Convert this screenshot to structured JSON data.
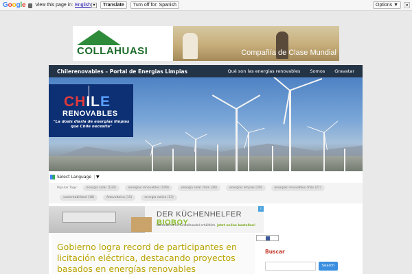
{
  "translate_bar": {
    "logo": "Google",
    "view_text": "View this page in:",
    "language": "English",
    "translate_label": "Translate",
    "turn_off_label": "Turn off for: Spanish",
    "options_label": "Options ▼",
    "close_label": "✕"
  },
  "top_ad": {
    "brand": "COLLAHUASI",
    "slogan": "Compañía de Clase Mundial"
  },
  "nav": {
    "site_title": "Chilerenovables – Portal de Energias Limpias",
    "links": [
      "Qué son las energías renovables",
      "Somos",
      "Gravatar"
    ]
  },
  "header_logo": {
    "chile_1": "CH",
    "chile_2": "IL",
    "chile_3": "E",
    "renovables": "RENOVABLES",
    "tagline": "\"La dosis diaria de energías limpias que Chile necesita\""
  },
  "language_selector": {
    "label": "Select Language",
    "arrow": "▼"
  },
  "tags": {
    "label": "Popular Tags:",
    "row1": [
      "energia solar (133)",
      "energias renovables (109)",
      "energia solar chile (36)",
      "energías limpias (30)",
      "energias renovables chile (21)"
    ],
    "row2": [
      "sustentabilidad (18)",
      "fotovoltaica (15)",
      "energia eolica (13)"
    ]
  },
  "ad_kuechen": {
    "headline_1": "DER KÜCHENHELFER ",
    "headline_2": "BIOBOY",
    "sub_1": "Demnächst im Einzelhandel erhältlich. ",
    "sub_2": "Jetzt online bestellen!",
    "badge": "i"
  },
  "post": {
    "title": "Gobierno logra record de participantes en licitación eléctrica, destacando proyectos basados en energías renovables"
  },
  "sidebar": {
    "search_heading": "Buscar",
    "search_placeholder": "",
    "search_button": "Search"
  }
}
